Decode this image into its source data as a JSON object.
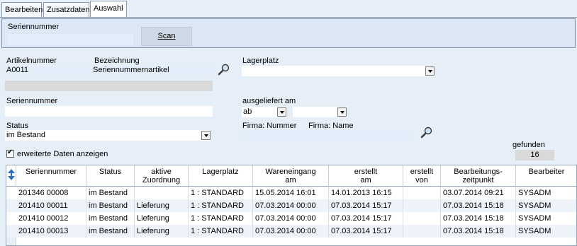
{
  "tabs": [
    {
      "label": "Bearbeiten"
    },
    {
      "label": "Zusatzdaten"
    },
    {
      "label": "Auswahl"
    }
  ],
  "scan_panel": {
    "serial_label": "Seriennummer",
    "serial_value": "",
    "scan_button": "Scan"
  },
  "article": {
    "number_label": "Artikelnummer",
    "number_value": "A0011",
    "desc_label": "Bezeichnung",
    "desc_value": "Seriennummernartikel"
  },
  "storage": {
    "label": "Lagerplatz",
    "value": ""
  },
  "serial": {
    "label": "Seriennummer",
    "value": ""
  },
  "delivered": {
    "label": "ausgeliefert am",
    "mode_value": "ab",
    "date_value": ""
  },
  "status": {
    "label": "Status",
    "value": "im Bestand"
  },
  "company": {
    "number_label": "Firma: Nummer",
    "number_value": "",
    "name_label": "Firma: Name",
    "name_value": ""
  },
  "extended": {
    "label": "erweiterte Daten anzeigen",
    "checked": true
  },
  "found": {
    "label": "gefunden",
    "count": "16"
  },
  "table": {
    "columns": [
      {
        "l1": "Seriennummer",
        "l2": ""
      },
      {
        "l1": "Status",
        "l2": ""
      },
      {
        "l1": "aktive",
        "l2": "Zuordnung"
      },
      {
        "l1": "Lagerplatz",
        "l2": ""
      },
      {
        "l1": "Wareneingang",
        "l2": "am"
      },
      {
        "l1": "erstellt",
        "l2": "am"
      },
      {
        "l1": "erstellt",
        "l2": "von"
      },
      {
        "l1": "Bearbeitungs-",
        "l2": "zeitpunkt"
      },
      {
        "l1": "Bearbeiter",
        "l2": ""
      }
    ],
    "rows": [
      [
        "201346 00008",
        "im Bestand",
        "",
        "1 : STANDARD",
        "15.05.2014 16:01",
        "14.01.2013 16:15",
        "",
        "03.07.2014 09:21",
        "SYSADM"
      ],
      [
        "201410 00011",
        "im Bestand",
        "Lieferung",
        "1 : STANDARD",
        "07.03.2014 00:00",
        "07.03.2014 15:17",
        "",
        "07.03.2014 15:18",
        "SYSADM"
      ],
      [
        "201410 00012",
        "im Bestand",
        "Lieferung",
        "1 : STANDARD",
        "07.03.2014 00:00",
        "07.03.2014 15:17",
        "",
        "07.03.2014 15:18",
        "SYSADM"
      ],
      [
        "201410 00013",
        "im Bestand",
        "Lieferung",
        "1 : STANDARD",
        "07.03.2014 00:00",
        "07.03.2014 15:17",
        "",
        "07.03.2014 15:18",
        "SYSADM"
      ]
    ]
  },
  "colors": {
    "background": "#e6eef7",
    "panel": "#dbe7f5",
    "row_alt": "#eef3fa"
  }
}
